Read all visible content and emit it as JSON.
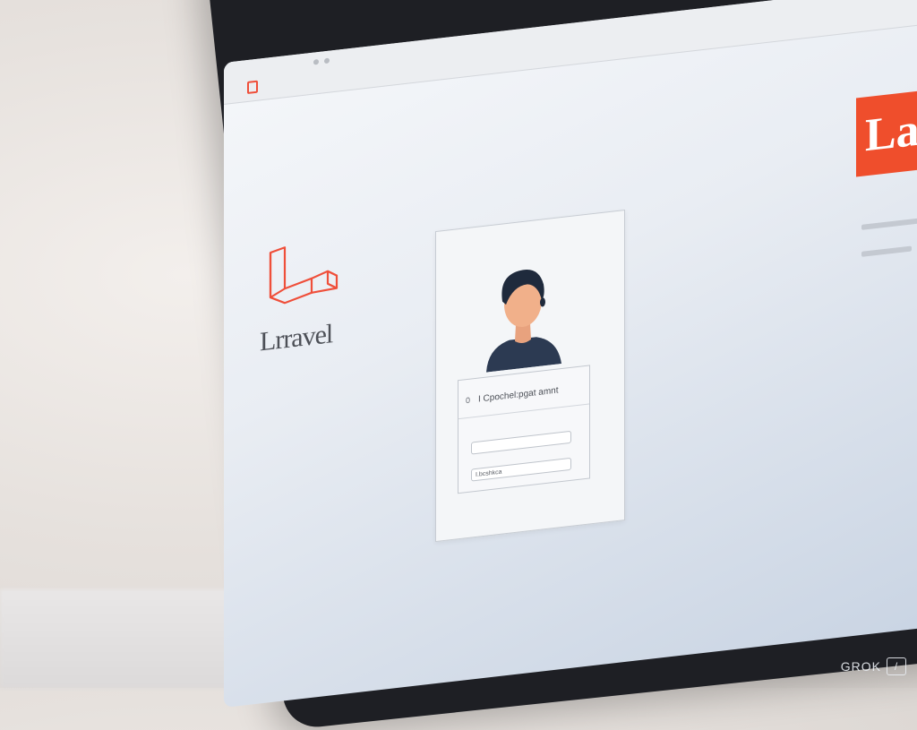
{
  "browser": {
    "tab_title": "",
    "url": ""
  },
  "left_panel": {
    "brand_name": "Lrravel",
    "logo_icon": "laravel-logo-icon",
    "logo_color": "#ef4f3a"
  },
  "login_card": {
    "avatar_icon": "user-avatar-icon",
    "header_icon_glyph": "0",
    "header_title": "I Cpochel:pgat amnt",
    "email_field": {
      "value": "",
      "placeholder": ""
    },
    "password_field": {
      "value": "I.bcshkca",
      "placeholder": ""
    }
  },
  "right_panel": {
    "banner_text": "Lar",
    "banner_color": "#ef4e2c"
  },
  "watermark": {
    "text": "GROK",
    "icon": "slash-icon",
    "glyph": "/"
  }
}
